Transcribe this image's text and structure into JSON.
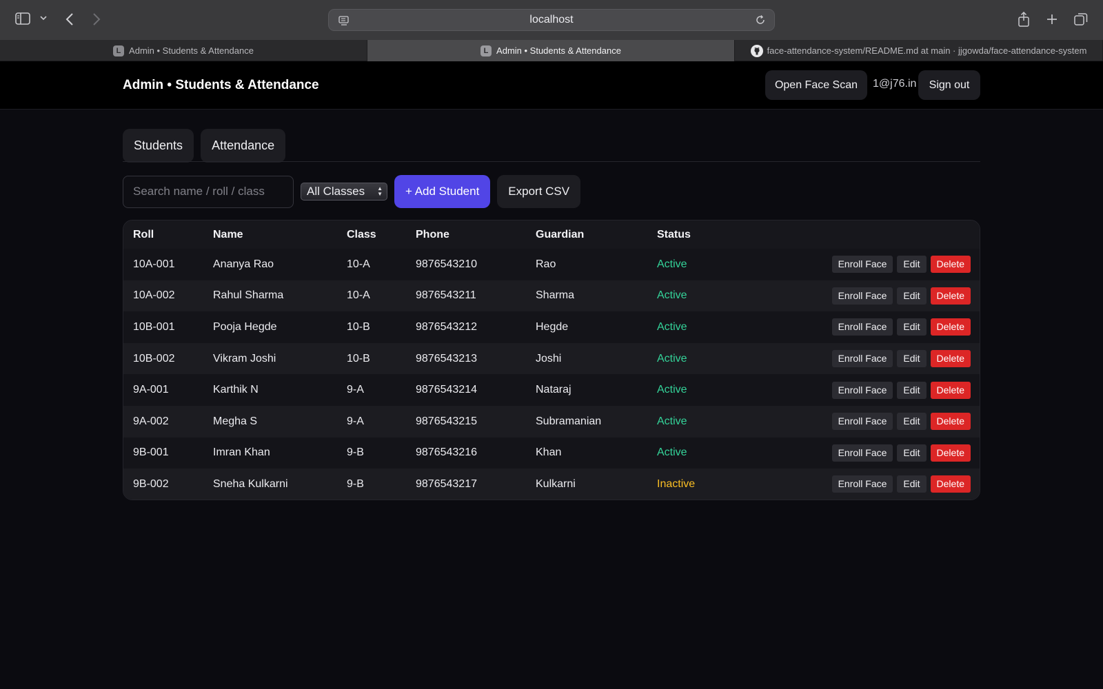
{
  "browser": {
    "url": "localhost",
    "tabs": [
      {
        "label": "Admin • Students & Attendance",
        "favicon": "L"
      },
      {
        "label": "Admin • Students & Attendance",
        "favicon": "L"
      },
      {
        "label": "face-attendance-system/README.md at main · jjgowda/face-attendance-system",
        "favicon": "github-icon"
      }
    ],
    "active_tab": 1
  },
  "header": {
    "title": "Admin • Students & Attendance",
    "open_face_scan": "Open Face Scan",
    "user_email": "1@j76.in",
    "sign_out": "Sign out"
  },
  "nav": {
    "tabs": [
      "Students",
      "Attendance"
    ]
  },
  "controls": {
    "search_placeholder": "Search name / roll / class",
    "class_filter": "All Classes",
    "add_student": "+ Add Student",
    "export_csv": "Export CSV"
  },
  "table": {
    "columns": [
      "Roll",
      "Name",
      "Class",
      "Phone",
      "Guardian",
      "Status"
    ],
    "action_labels": {
      "enroll": "Enroll Face",
      "edit": "Edit",
      "delete": "Delete"
    },
    "rows": [
      {
        "roll": "10A-001",
        "name": "Ananya Rao",
        "class": "10-A",
        "phone": "9876543210",
        "guardian": "Rao",
        "status": "Active"
      },
      {
        "roll": "10A-002",
        "name": "Rahul Sharma",
        "class": "10-A",
        "phone": "9876543211",
        "guardian": "Sharma",
        "status": "Active"
      },
      {
        "roll": "10B-001",
        "name": "Pooja Hegde",
        "class": "10-B",
        "phone": "9876543212",
        "guardian": "Hegde",
        "status": "Active"
      },
      {
        "roll": "10B-002",
        "name": "Vikram Joshi",
        "class": "10-B",
        "phone": "9876543213",
        "guardian": "Joshi",
        "status": "Active"
      },
      {
        "roll": "9A-001",
        "name": "Karthik N",
        "class": "9-A",
        "phone": "9876543214",
        "guardian": "Nataraj",
        "status": "Active"
      },
      {
        "roll": "9A-002",
        "name": "Megha S",
        "class": "9-A",
        "phone": "9876543215",
        "guardian": "Subramanian",
        "status": "Active"
      },
      {
        "roll": "9B-001",
        "name": "Imran Khan",
        "class": "9-B",
        "phone": "9876543216",
        "guardian": "Khan",
        "status": "Active"
      },
      {
        "roll": "9B-002",
        "name": "Sneha Kulkarni",
        "class": "9-B",
        "phone": "9876543217",
        "guardian": "Kulkarni",
        "status": "Inactive"
      }
    ]
  },
  "colors": {
    "accent": "#5145e6",
    "active": "#34d399",
    "inactive": "#fbbf24",
    "danger": "#dc2626"
  }
}
